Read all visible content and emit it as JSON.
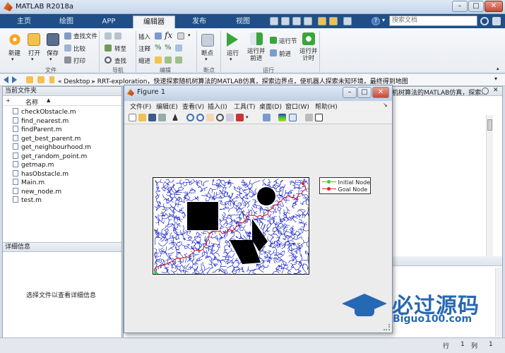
{
  "app": {
    "title": "MATLAB R2018a"
  },
  "tabs": [
    "主页",
    "绘图",
    "APP",
    "编辑器",
    "发布",
    "视图"
  ],
  "search": {
    "placeholder": "搜索文档"
  },
  "ribbon": {
    "file_group": {
      "label": "文件",
      "new": "新建",
      "open": "打开",
      "save": "保存",
      "find_files": "查找文件",
      "compare": "比较",
      "print": "打印"
    },
    "nav_group": {
      "label": "导航",
      "goto": "转至",
      "find": "查找"
    },
    "edit_group": {
      "label": "编辑",
      "insert": "插入",
      "comment": "注释",
      "indent": "缩进"
    },
    "breakpoint_group": {
      "label": "断点",
      "breakpoints": "断点"
    },
    "run_group": {
      "label": "运行",
      "run": "运行",
      "run_advance": "运行并\n前进",
      "run_section": "运行节",
      "advance": "前进",
      "run_time": "运行并\n计时"
    }
  },
  "address": {
    "path_prefix": "«",
    "desktop": "Desktop",
    "folder": "RRT-exploration，快速探索随机树算法的MATLAB仿真，探索边界点，使机器人探索未知环境，最终得到地图",
    "right_tail": "机树算法的MATLAB仿真，探索..."
  },
  "current_folder": {
    "title": "当前文件夹",
    "column": "名称",
    "sort": "▲",
    "files": [
      "checkObstacle.m",
      "find_nearest.m",
      "findParent.m",
      "get_best_parent.m",
      "get_neighbourhood.m",
      "get_random_point.m",
      "getmap.m",
      "hasObstacle.m",
      "Main.m",
      "new_node.m",
      "test.m"
    ]
  },
  "details": {
    "title": "详细信息",
    "hint": "选择文件以查看详细信息"
  },
  "figure": {
    "title": "Figure 1",
    "menu": [
      "文件(F)",
      "编辑(E)",
      "查看(V)",
      "插入(I)",
      "工具(T)",
      "桌面(D)",
      "窗口(W)",
      "帮助(H)"
    ],
    "legend": [
      {
        "name": "Initial Node",
        "color": "#22dd22"
      },
      {
        "name": "Goal Node",
        "color": "#dd2222"
      }
    ],
    "tree_color": "#1f28c8",
    "path_color": "#d81f1f"
  },
  "status": {
    "row_label": "行",
    "row": "1",
    "col_label": "列",
    "col": "1"
  },
  "watermark": {
    "brand": "必过源码",
    "url": "Biguo100.com"
  }
}
